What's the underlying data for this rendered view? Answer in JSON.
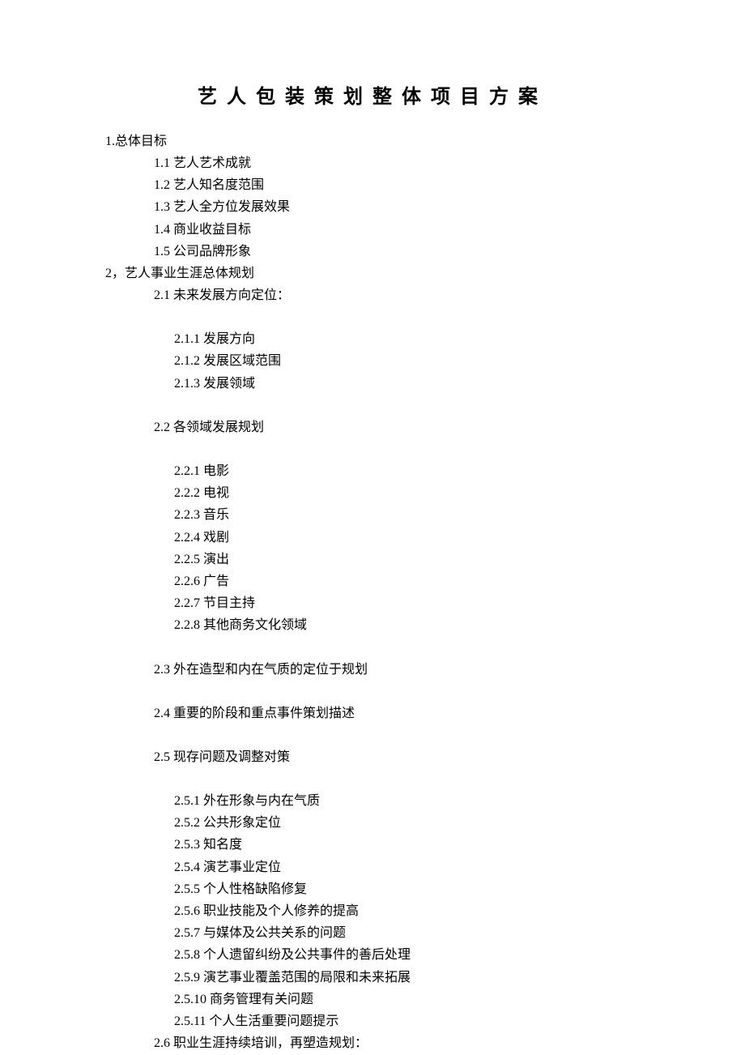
{
  "title": "艺人包装策划整体项目方案",
  "outline": [
    {
      "level": 0,
      "text": "1.总体目标"
    },
    {
      "level": 1,
      "text": "1.1 艺人艺术成就"
    },
    {
      "level": 1,
      "text": "1.2 艺人知名度范围"
    },
    {
      "level": 1,
      "text": "1.3 艺人全方位发展效果"
    },
    {
      "level": 1,
      "text": "1.4 商业收益目标"
    },
    {
      "level": 1,
      "text": "1.5 公司品牌形象"
    },
    {
      "level": 0,
      "text": "2，艺人事业生涯总体规划"
    },
    {
      "level": 1,
      "text": "2.1 未来发展方向定位："
    },
    {
      "level": "spacer"
    },
    {
      "level": 2,
      "text": "2.1.1 发展方向"
    },
    {
      "level": 2,
      "text": "2.1.2 发展区域范围"
    },
    {
      "level": 2,
      "text": "2.1.3 发展领域"
    },
    {
      "level": "spacer"
    },
    {
      "level": 1,
      "text": "2.2 各领域发展规划"
    },
    {
      "level": "spacer"
    },
    {
      "level": 2,
      "text": "2.2.1 电影"
    },
    {
      "level": 2,
      "text": "2.2.2 电视"
    },
    {
      "level": 2,
      "text": "2.2.3 音乐"
    },
    {
      "level": 2,
      "text": "2.2.4 戏剧"
    },
    {
      "level": 2,
      "text": "2.2.5 演出"
    },
    {
      "level": 2,
      "text": "2.2.6 广告"
    },
    {
      "level": 2,
      "text": "2.2.7 节目主持"
    },
    {
      "level": 2,
      "text": "2.2.8 其他商务文化领域"
    },
    {
      "level": "spacer"
    },
    {
      "level": 1,
      "text": "2.3 外在造型和内在气质的定位于规划"
    },
    {
      "level": "spacer"
    },
    {
      "level": 1,
      "text": "2.4 重要的阶段和重点事件策划描述"
    },
    {
      "level": "spacer"
    },
    {
      "level": 1,
      "text": "2.5 现存问题及调整对策"
    },
    {
      "level": "spacer"
    },
    {
      "level": 2,
      "text": "2.5.1 外在形象与内在气质"
    },
    {
      "level": 2,
      "text": "2.5.2 公共形象定位"
    },
    {
      "level": 2,
      "text": "2.5.3 知名度"
    },
    {
      "level": 2,
      "text": "2.5.4 演艺事业定位"
    },
    {
      "level": 2,
      "text": "2.5.5 个人性格缺陷修复"
    },
    {
      "level": 2,
      "text": "2.5.6 职业技能及个人修养的提高"
    },
    {
      "level": 2,
      "text": "2.5.7 与媒体及公共关系的问题"
    },
    {
      "level": 2,
      "text": "2.5.8 个人遗留纠纷及公共事件的善后处理"
    },
    {
      "level": 2,
      "text": "2.5.9 演艺事业覆盖范围的局限和未来拓展"
    },
    {
      "level": 2,
      "text": "2.5.10 商务管理有关问题"
    },
    {
      "level": 2,
      "text": "2.5.11 个人生活重要问题提示"
    },
    {
      "level": 1,
      "text": "2.6 职业生涯持续培训，再塑造规划："
    }
  ]
}
